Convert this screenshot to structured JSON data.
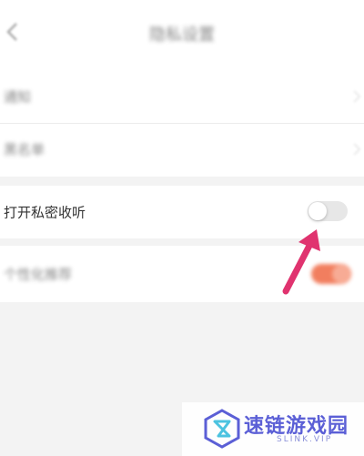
{
  "header": {
    "back_icon": "chevron-left-icon",
    "title": "隐私设置"
  },
  "rows": [
    {
      "label": "通知",
      "icon": "chevron-right-icon"
    },
    {
      "label": "黑名单",
      "icon": "chevron-right-icon"
    }
  ],
  "private_listening": {
    "label": "打开私密收听",
    "toggle_state": "off"
  },
  "second_toggle": {
    "label": "个性化推荐",
    "toggle_state": "on",
    "color": "#f0714e"
  },
  "annotation": {
    "icon": "arrow-pointer-icon",
    "color": "#e0336f"
  },
  "watermark": {
    "text": "速链游戏园",
    "subtext": "SLINK.VIP",
    "color": "#5b5fd6"
  }
}
